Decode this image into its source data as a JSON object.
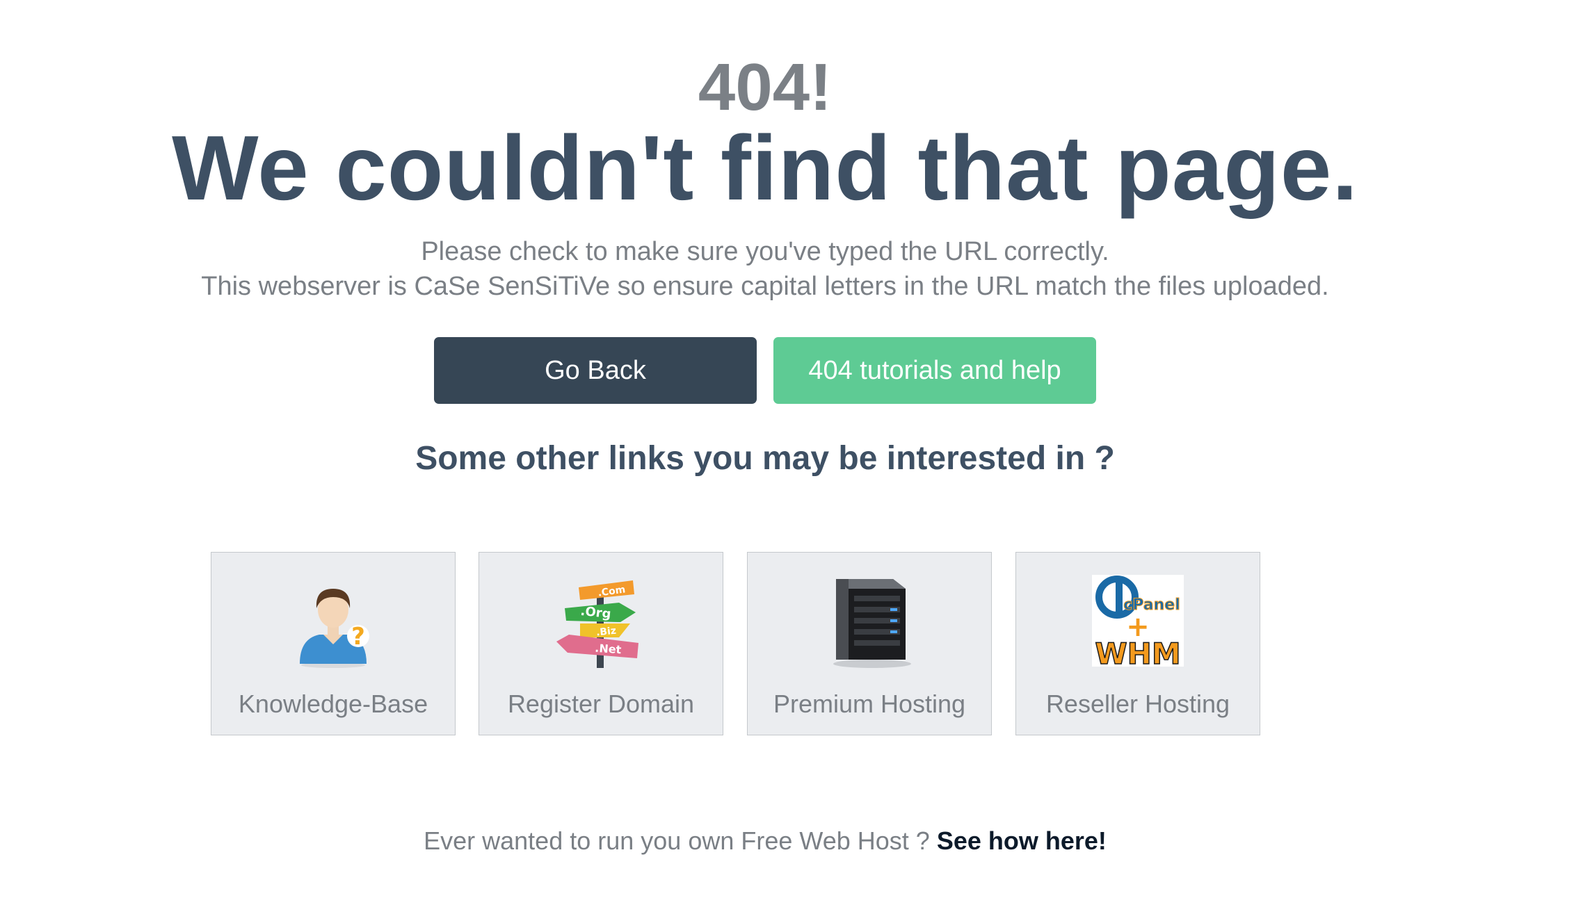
{
  "error": {
    "code": "404!",
    "headline": "We couldn't find that page.",
    "line1": "Please check to make sure you've typed the URL correctly.",
    "line2": "This webserver is CaSe SenSiTiVe so ensure capital letters in the URL match the files uploaded."
  },
  "buttons": {
    "back_label": "Go Back",
    "help_label": "404 tutorials and help",
    "back_color": "#364655",
    "help_color": "#5ecb94"
  },
  "links_heading": "Some other links you may be interested in ?",
  "cards": [
    {
      "label": "Knowledge-Base",
      "icon": "person-question-icon"
    },
    {
      "label": "Register Domain",
      "icon": "domain-signpost-icon"
    },
    {
      "label": "Premium Hosting",
      "icon": "server-icon"
    },
    {
      "label": "Reseller Hosting",
      "icon": "cpanel-whm-icon"
    }
  ],
  "signpost_words": [
    ".Com",
    ".Org",
    ".Biz",
    ".Net"
  ],
  "cpanel_logo": {
    "top": "cPanel",
    "plus": "+",
    "bottom": "WHM"
  },
  "footer": {
    "text": "Ever wanted to run you own Free Web Host ? ",
    "link": "See how here!"
  }
}
